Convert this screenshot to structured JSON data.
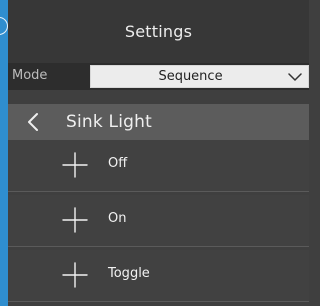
{
  "header": {
    "title": "Settings"
  },
  "mode": {
    "label": "Mode",
    "selected": "Sequence"
  },
  "subheader": {
    "title": "Sink Light"
  },
  "list": {
    "items": [
      {
        "label": "Off"
      },
      {
        "label": "On"
      },
      {
        "label": "Toggle"
      }
    ]
  },
  "colors": {
    "accent_blue": "#2f8ecf",
    "header_bg": "#373737",
    "body_bg": "#3f3f3f",
    "subheader_bg": "#5c5c5c",
    "select_bg": "#ececec"
  },
  "icons": {
    "back": "chevron-left-icon",
    "dropdown": "chevron-down-icon",
    "add": "plus-icon"
  }
}
